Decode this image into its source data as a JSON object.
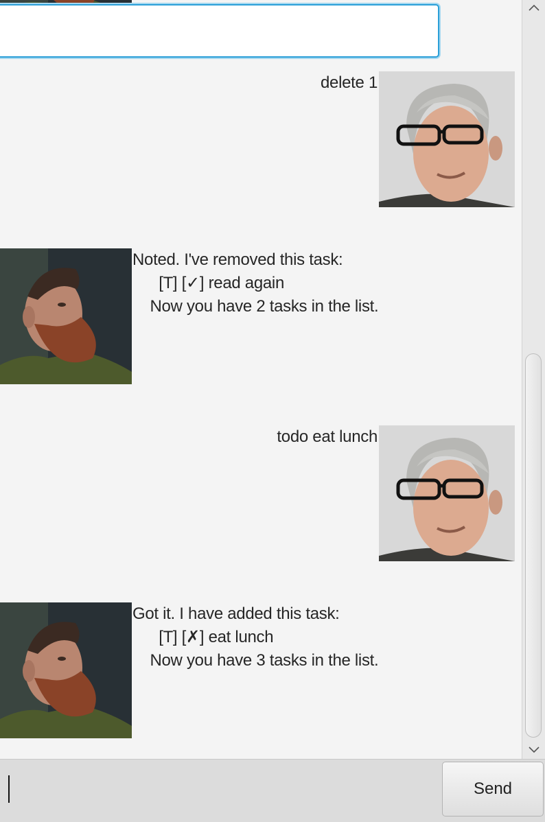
{
  "conversation": [
    {
      "sender": "duke",
      "lines": []
    },
    {
      "sender": "user",
      "lines": [
        "delete 1"
      ]
    },
    {
      "sender": "duke",
      "lines": [
        "Noted. I've removed this task:",
        "      [T] [✓] read again",
        "    Now you have 2 tasks in the list."
      ]
    },
    {
      "sender": "user",
      "lines": [
        "todo eat lunch"
      ]
    },
    {
      "sender": "duke",
      "lines": [
        "Got it. I have added this task:",
        "      [T] [✗] eat lunch",
        "    Now you have 3 tasks in the list."
      ]
    }
  ],
  "input": {
    "value": "",
    "placeholder": ""
  },
  "send_button": {
    "label": "Send"
  },
  "icons": {
    "bot_avatar": "bearded-man-avatar",
    "user_avatar": "grey-haired-man-with-glasses-avatar",
    "scroll_up": "chevron-up-icon",
    "scroll_down": "chevron-down-icon"
  },
  "colors": {
    "background": "#f4f4f4",
    "focus_ring": "#2a9fd8",
    "text": "#262626"
  }
}
